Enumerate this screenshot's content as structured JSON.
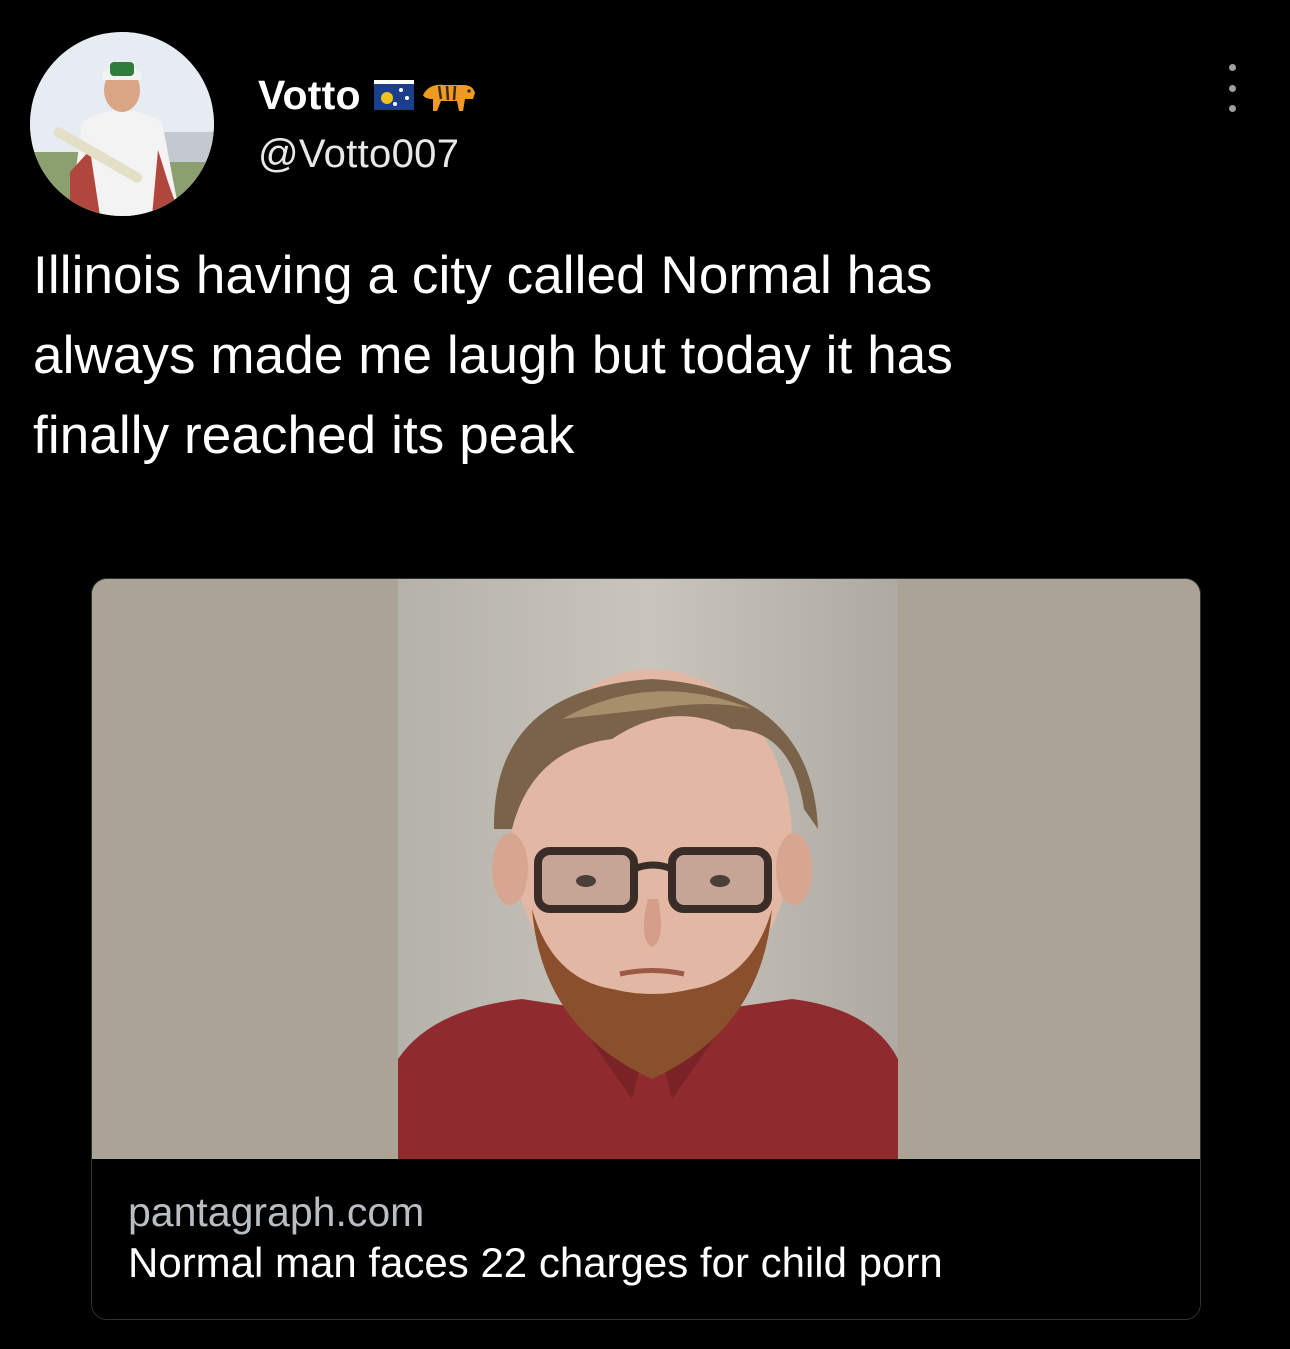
{
  "tweet": {
    "display_name": "Votto",
    "name_emoji": [
      "flag-icon",
      "tiger-icon"
    ],
    "handle": "@Votto007",
    "text_lines": [
      "Illinois having a city called Normal has",
      "always made me laugh but today it has",
      "finally reached its peak"
    ]
  },
  "card": {
    "domain": "pantagraph.com",
    "title": "Normal man faces 22 charges for child porn"
  },
  "colors": {
    "background": "#000000",
    "text_primary": "#ffffff",
    "text_secondary": "#b9bec4",
    "card_border": "#2f3336"
  }
}
